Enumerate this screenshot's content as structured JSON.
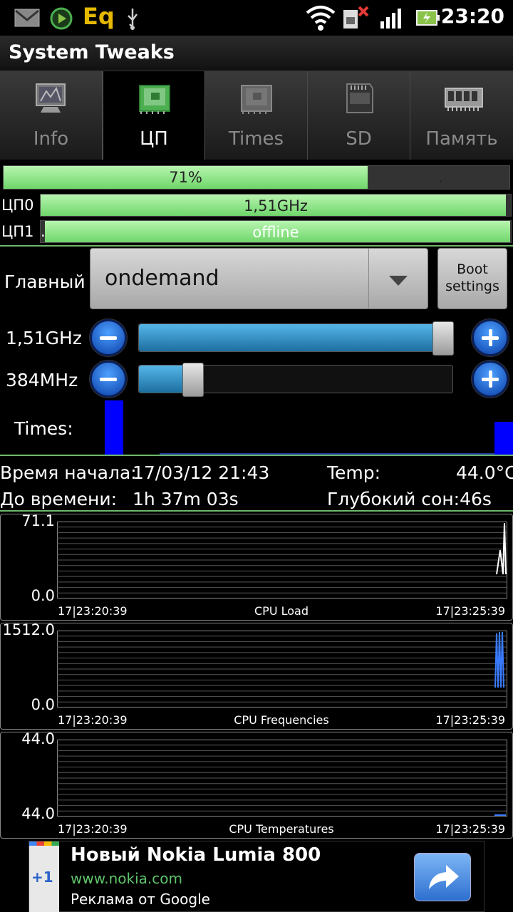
{
  "status_bar": {
    "time": "23:20",
    "icons": [
      "gmail-icon",
      "media-player-icon",
      "eq-icon",
      "usb-icon",
      "wifi-icon",
      "sim-error-icon",
      "signal-icon",
      "battery-charging-icon"
    ],
    "eq_text": "Eq"
  },
  "app": {
    "title": "System Tweaks"
  },
  "tabs": [
    {
      "label": "Info",
      "icon": "monitor-icon",
      "active": false
    },
    {
      "label": "ЦП",
      "icon": "cpu-chip-icon",
      "active": true
    },
    {
      "label": "Times",
      "icon": "cpu-chip-gray-icon",
      "active": false
    },
    {
      "label": "SD",
      "icon": "sd-card-icon",
      "active": false
    },
    {
      "label": "Память",
      "icon": "memory-module-icon",
      "active": false
    }
  ],
  "cpu_load": {
    "label": "71%",
    "value_percent": 71,
    "secondary_label": "."
  },
  "cores": [
    {
      "name": "ЦП0",
      "value": "1,51GHz",
      "fill_percent": 99
    },
    {
      "name": "ЦП1",
      "value": "offline",
      "fill_percent": 100,
      "marker": "."
    }
  ],
  "governor": {
    "label": "Главный",
    "value": "ondemand",
    "boot_button": "Boot\nsettings"
  },
  "freq": {
    "max": {
      "label": "1,51GHz",
      "slider_percent": 100
    },
    "min": {
      "label": "384MHz",
      "slider_percent": 17
    }
  },
  "times_label": "Times:",
  "stats": {
    "start_label": "Время начала:",
    "start_value": "17/03/12 21:43",
    "temp_label": "Temp:",
    "temp_value": "44.0°C",
    "uptime_label": "До времени:",
    "uptime_value": "1h 37m 03s",
    "deep_sleep": "Глубокий сон:46s"
  },
  "graphs": [
    {
      "title": "CPU Load",
      "max": "71.1",
      "min": "0.0",
      "start": "17|23:20:39",
      "end": "17|23:25:39",
      "line_color": "#ffffff"
    },
    {
      "title": "CPU Frequencies",
      "max": "1512.0",
      "min": "0.0",
      "start": "17|23:20:39",
      "end": "17|23:25:39",
      "line_color": "#3a7bff"
    },
    {
      "title": "CPU Temperatures",
      "max": "44.0",
      "min": "44.0",
      "start": "17|23:20:39",
      "end": "17|23:25:39",
      "line_color": "#3a7bff"
    }
  ],
  "ad": {
    "plus_label": "+1",
    "title": "Новый Nokia Lumia 800",
    "url": "www.nokia.com",
    "sub": "Реклама от Google"
  },
  "colors": {
    "accent_green": "#6fd66a",
    "slider_blue": "#2a8cc4",
    "button_blue": "#1f6fe0"
  }
}
